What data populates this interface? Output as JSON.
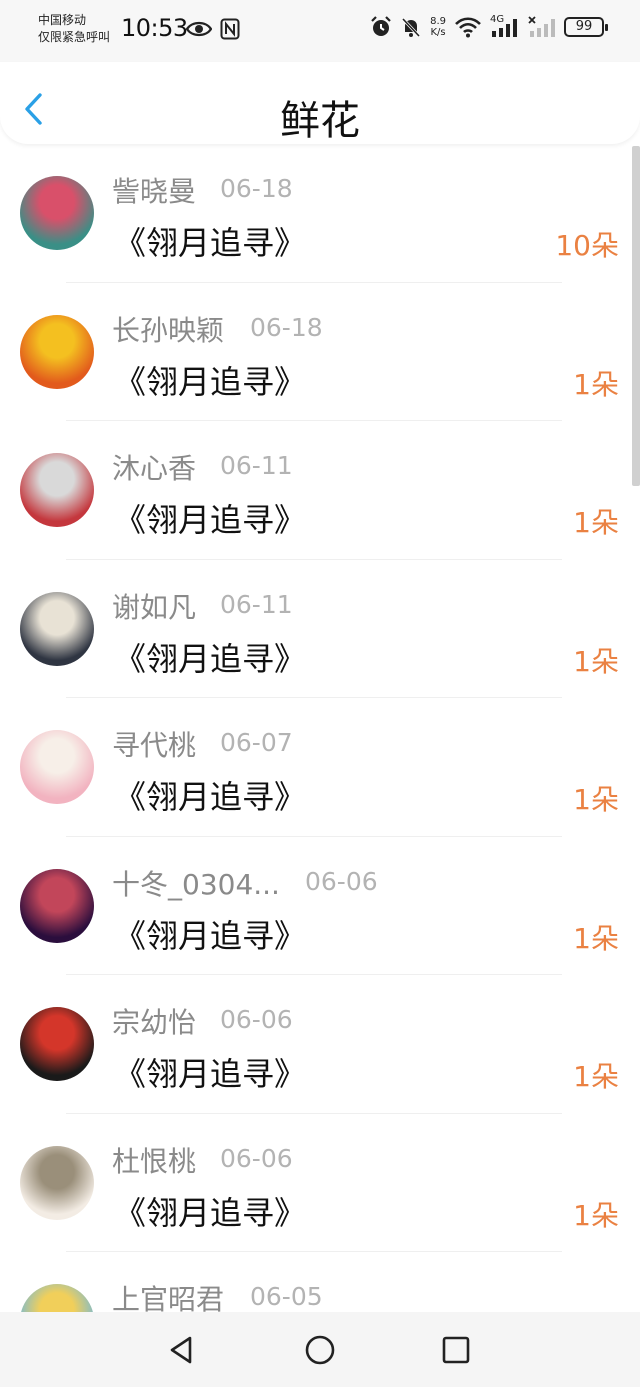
{
  "status_bar": {
    "carrier_line1": "中国移动",
    "carrier_line2": "仅限紧急呼叫",
    "time": "10:53",
    "net_speed_value": "8.9",
    "net_speed_unit": "K/s",
    "network_type": "4G",
    "battery": "99"
  },
  "header": {
    "title": "鲜花"
  },
  "items": [
    {
      "name": "訾晓曼",
      "date": "06-18",
      "book": "《翎月追寻》",
      "count": "10朵",
      "avatar_colors": [
        "#3a8f86",
        "#d9506a"
      ]
    },
    {
      "name": "长孙映颖",
      "date": "06-18",
      "book": "《翎月追寻》",
      "count": "1朵",
      "avatar_colors": [
        "#e25a1c",
        "#f4c020"
      ]
    },
    {
      "name": "沐心香",
      "date": "06-11",
      "book": "《翎月追寻》",
      "count": "1朵",
      "avatar_colors": [
        "#c4373d",
        "#d9d9d9"
      ]
    },
    {
      "name": "谢如凡",
      "date": "06-11",
      "book": "《翎月追寻》",
      "count": "1朵",
      "avatar_colors": [
        "#2f3542",
        "#e8e2d5"
      ]
    },
    {
      "name": "寻代桃",
      "date": "06-07",
      "book": "《翎月追寻》",
      "count": "1朵",
      "avatar_colors": [
        "#f2b3c0",
        "#f7efe8"
      ]
    },
    {
      "name": "十冬_0304...",
      "date": "06-06",
      "book": "《翎月追寻》",
      "count": "1朵",
      "avatar_colors": [
        "#2b0e3d",
        "#c2465a"
      ]
    },
    {
      "name": "宗幼怡",
      "date": "06-06",
      "book": "《翎月追寻》",
      "count": "1朵",
      "avatar_colors": [
        "#1a1a1a",
        "#d4362a"
      ]
    },
    {
      "name": "杜恨桃",
      "date": "06-06",
      "book": "《翎月追寻》",
      "count": "1朵",
      "avatar_colors": [
        "#f3ece4",
        "#9a8f7a"
      ]
    },
    {
      "name": "上官昭君",
      "date": "06-05",
      "book": "",
      "count": "",
      "avatar_colors": [
        "#6cb8e0",
        "#f1cf5a"
      ]
    }
  ]
}
